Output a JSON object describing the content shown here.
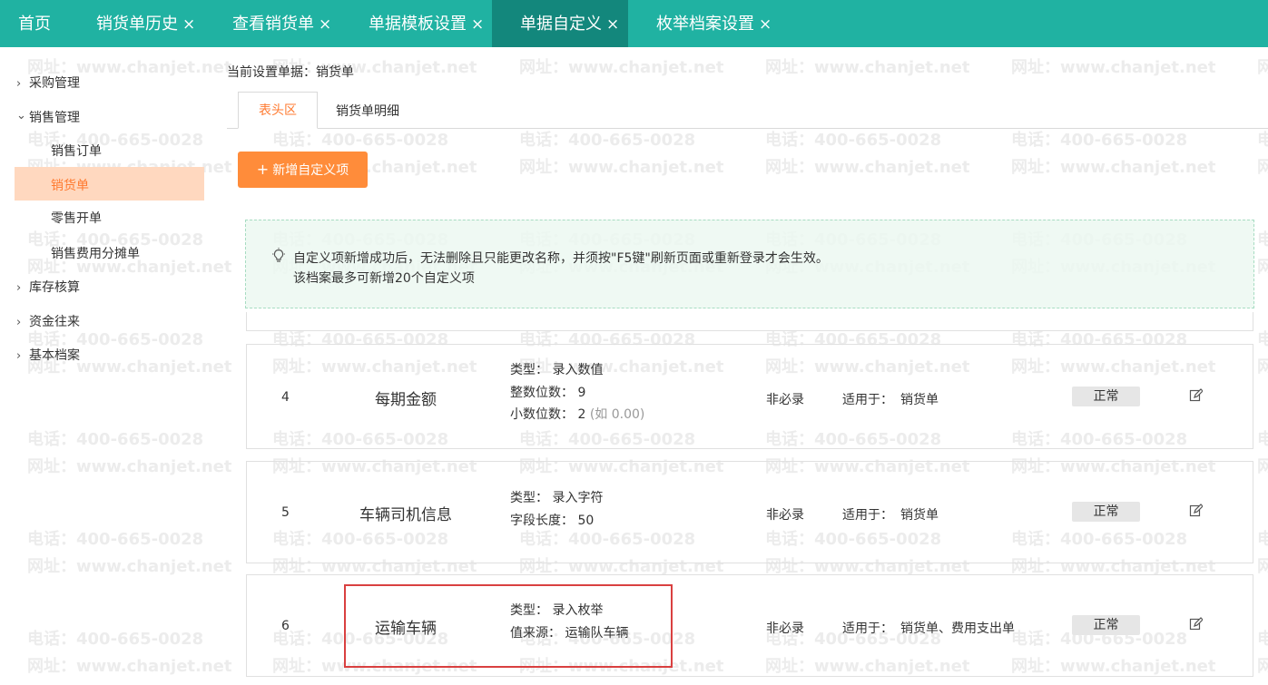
{
  "watermark": {
    "phone": "电话：400-665-0028",
    "site": "网址：www.chanjet.net"
  },
  "top_tabs": [
    {
      "label": "首页",
      "closable": false
    },
    {
      "label": "销货单历史",
      "closable": true
    },
    {
      "label": "查看销货单",
      "closable": true
    },
    {
      "label": "单据模板设置",
      "closable": true
    },
    {
      "label": "单据自定义",
      "closable": true,
      "active": true
    },
    {
      "label": "枚举档案设置",
      "closable": true
    }
  ],
  "close_glyph": "×",
  "sidebar": {
    "chevron_right": "›",
    "chevron_down": "⌄",
    "items": [
      {
        "label": "采购管理",
        "expanded": false
      },
      {
        "label": "销售管理",
        "expanded": true
      },
      {
        "label": "库存核算",
        "expanded": false
      },
      {
        "label": "资金往来",
        "expanded": false
      },
      {
        "label": "基本档案",
        "expanded": false
      }
    ],
    "sales_children": [
      {
        "label": "销售订单"
      },
      {
        "label": "销货单",
        "active": true
      },
      {
        "label": "零售开单"
      },
      {
        "label": "销售费用分摊单"
      }
    ]
  },
  "main": {
    "current_doc": "当前设置单据：销货单",
    "tabs": [
      {
        "label": "表头区",
        "active": true
      },
      {
        "label": "销货单明细"
      }
    ],
    "add_button": {
      "icon": "+",
      "label": "新增自定义项"
    },
    "notice": {
      "icon": "lightbulb-icon",
      "line1": "自定义项新增成功后，无法删除且只能更改名称，并须按\"F5键\"刷新页面或重新登录才会生效。",
      "line2": "该档案最多可新增20个自定义项"
    },
    "rows": [
      {
        "index": "4",
        "name": "每期金额",
        "details": [
          {
            "label": "类型：",
            "value": "录入数值"
          },
          {
            "label": "整数位数：",
            "value": "9"
          },
          {
            "label": "小数位数：",
            "value": "2",
            "hint": "(如 0.00)"
          }
        ],
        "required": "非必录",
        "apply_label": "适用于：",
        "apply_value": "销货单",
        "status": "正常"
      },
      {
        "index": "5",
        "name": "车辆司机信息",
        "details": [
          {
            "label": "类型：",
            "value": "录入字符"
          },
          {
            "label": "字段长度：",
            "value": "50"
          }
        ],
        "required": "非必录",
        "apply_label": "适用于：",
        "apply_value": "销货单",
        "status": "正常"
      },
      {
        "index": "6",
        "name": "运输车辆",
        "details": [
          {
            "label": "类型：",
            "value": "录入枚举"
          },
          {
            "label": "值来源：",
            "value": "运输队车辆"
          }
        ],
        "required": "非必录",
        "apply_label": "适用于：",
        "apply_value": "销货单、费用支出单",
        "status": "正常"
      }
    ]
  },
  "colors": {
    "topbar": "#20b2a2",
    "topbar_active": "#13877c",
    "accent": "#ff8c3a",
    "sidebar_active_bg": "#ffd8bf",
    "highlight": "#d94040"
  }
}
